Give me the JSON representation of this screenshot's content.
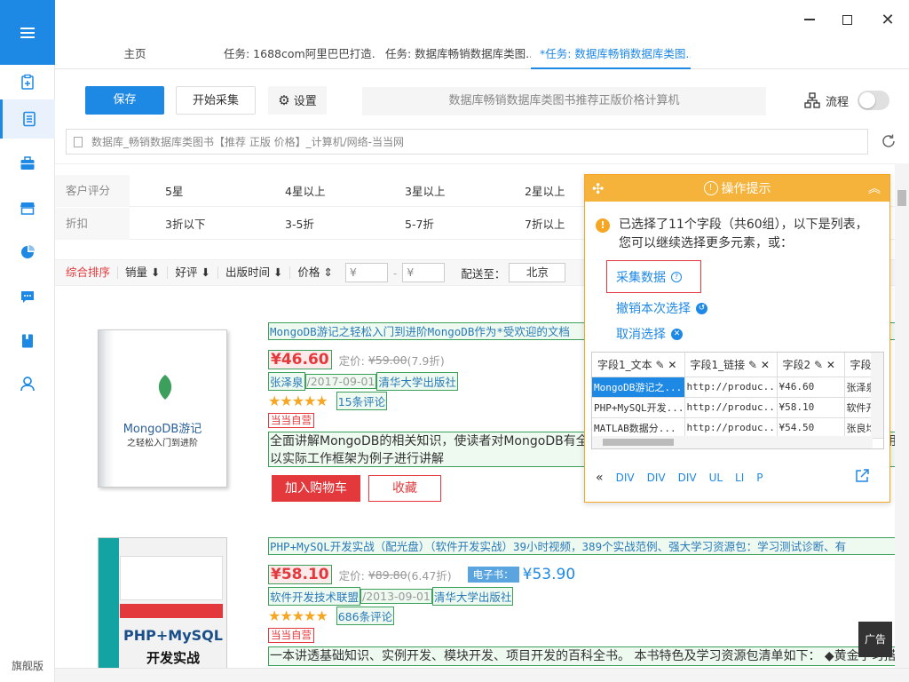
{
  "app": {
    "flagship_label": "旗舰版"
  },
  "tabs": [
    "主页",
    "任务: 1688com阿里巴巴打造...",
    "任务: 数据库畅销数据库类图...",
    "*任务: 数据库畅销数据库类图..."
  ],
  "toolbar": {
    "save_label": "保存",
    "start_label": "开始采集",
    "settings_label": "设置",
    "task_title": "数据库畅销数据库类图书推荐正版价格计算机",
    "flow_label": "流程",
    "flow_enabled": false
  },
  "url": "数据库_畅销数据库类图书【推荐 正版 价格】_计算机/网络-当当网",
  "filters": [
    {
      "label": "客户评分",
      "options": [
        "5星",
        "4星以上",
        "3星以上",
        "2星以上"
      ]
    },
    {
      "label": "折扣",
      "options": [
        "3折以下",
        "3-5折",
        "5-7折",
        "7折以上"
      ]
    }
  ],
  "sort": {
    "items": [
      "综合排序",
      "销量",
      "好评",
      "出版时间",
      "价格"
    ],
    "price_from_placeholder": "¥",
    "price_to_placeholder": "¥",
    "ship_to_label": "配送至：",
    "ship_to_value": "北京"
  },
  "products": [
    {
      "title": "MongoDB游记之轻松入门到进阶MongoDB作为*受欢迎的文档",
      "price": "¥46.60",
      "orig_label": "定价:",
      "orig_price": "¥59.00",
      "discount": "(7.9折)",
      "author": "张泽泉",
      "date": "/2017-09-01",
      "publisher": "清华大学出版社",
      "stars": "★★★★★",
      "reviews": "15条评论",
      "selfop": "当当自营",
      "desc": "全面讲解MongoDB的相关知识，使读者对MongoDB有全面的认识。本书还介绍了MongoDB的安装、部署与使用以实际工作框架为例子进行讲解",
      "cart_label": "加入购物车",
      "fav_label": "收藏",
      "cover_title": "MongoDB游记",
      "cover_sub": "之轻松入门到进阶"
    },
    {
      "title": "PHP+MySQL开发实战（配光盘）（软件开发实战）39小时视频，389个实战范例、强大学习资源包：学习测试诊断、有",
      "price": "¥58.10",
      "orig_label": "定价:",
      "orig_price": "¥89.80",
      "discount": "(6.47折)",
      "ebook_label": "电子书：",
      "ebook_price": "¥53.90",
      "author": "软件开发技术联盟",
      "date": "/2013-09-01",
      "publisher": "清华大学出版社",
      "stars": "★★★★★",
      "reviews": "686条评论",
      "selfop": "当当自营",
      "desc": "一本讲透基础知识、实例开发、模块开发、项目开发的百科全书。 本书特色及学习资源包清单如下： ◆黄金学习搭档",
      "cover_title": "PHP+MySQL",
      "cover_sub": "开发实战"
    }
  ],
  "ad_label": "广告",
  "ops_panel": {
    "title": "操作提示",
    "message": "已选择了11个字段（共60组），以下是列表，您可以继续选择更多元素，或：",
    "collect_label": "采集数据",
    "undo_label": "撤销本次选择",
    "cancel_label": "取消选择",
    "columns": [
      "字段1_文本",
      "字段1_链接",
      "字段2",
      "字段3"
    ],
    "rows": [
      [
        "MongoDB游记之...",
        "http://produc...",
        "¥46.60",
        "张泽泉"
      ],
      [
        "PHP+MySQL开发...",
        "http://produc...",
        "¥58.10",
        "软件开"
      ],
      [
        "MATLAB数据分...",
        "http://produc...",
        "¥54.50",
        "张良均"
      ]
    ],
    "breadcrumb": [
      "DIV",
      "DIV",
      "DIV",
      "UL",
      "LI",
      "P"
    ]
  },
  "colors": {
    "accent": "#1e88e5",
    "warn": "#f5a623",
    "price": "#e4393c",
    "select_box": "#3c9f5c"
  }
}
